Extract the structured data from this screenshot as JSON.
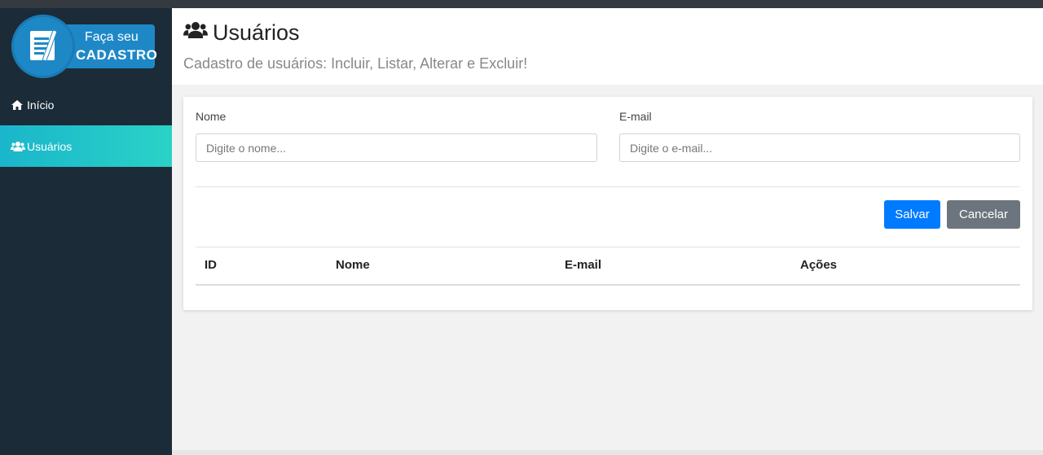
{
  "logo": {
    "line1": "Faça seu",
    "line2": "CADASTRO"
  },
  "sidebar": {
    "items": [
      {
        "label": "Início",
        "icon": "home-icon"
      },
      {
        "label": "Usuários",
        "icon": "users-icon",
        "active": true
      }
    ]
  },
  "header": {
    "title": "Usuários",
    "subtitle": "Cadastro de usuários: Incluir, Listar, Alterar e Excluir!"
  },
  "form": {
    "name_label": "Nome",
    "name_placeholder": "Digite o nome...",
    "email_label": "E-mail",
    "email_placeholder": "Digite o e-mail...",
    "save_label": "Salvar",
    "cancel_label": "Cancelar"
  },
  "table": {
    "columns": [
      "ID",
      "Nome",
      "E-mail",
      "Ações"
    ],
    "rows": []
  },
  "colors": {
    "sidebar_bg": "#1b2b38",
    "active_nav": "#22c4c9",
    "primary": "#007bff",
    "secondary": "#6c757d"
  }
}
